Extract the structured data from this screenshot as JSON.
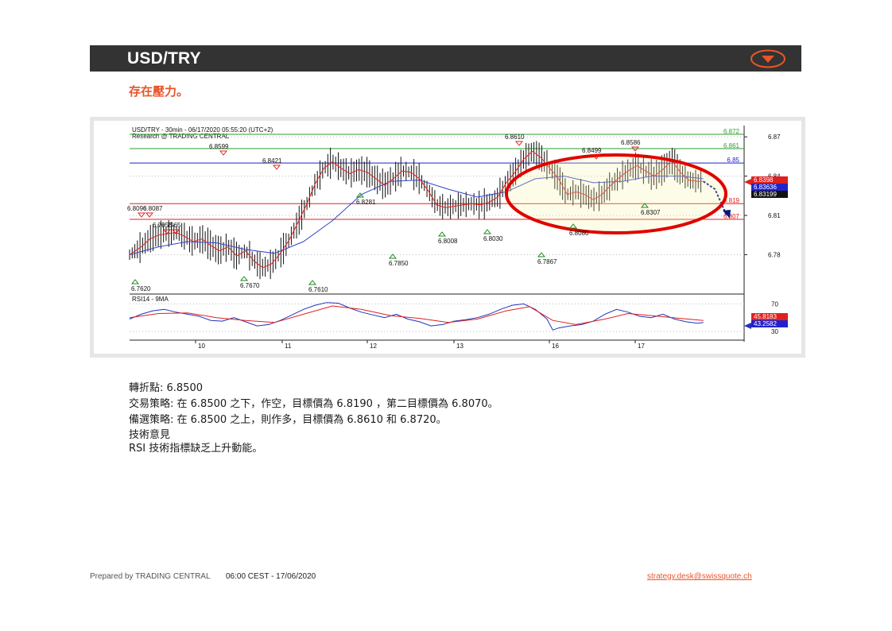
{
  "header": {
    "title": "USD/TRY",
    "menu_icon": "chevron-down-circle-icon",
    "accent": "#e8552a"
  },
  "subtitle": "存在壓力。",
  "chart_data": {
    "type": "line",
    "title": "USD/TRY - 30min - 06/17/2020 05:55:20 (UTC+2)",
    "subtitle": "Research @ TRADING CENTRAL",
    "x_ticks": [
      "10",
      "11",
      "12",
      "13",
      "16",
      "17"
    ],
    "y_ticks": [
      "6.87",
      "6.84",
      "6.81",
      "6.78"
    ],
    "ylim": [
      6.756,
      6.875
    ],
    "levels": [
      {
        "value": 6.872,
        "label": "6.872",
        "color": "#2e9e2e"
      },
      {
        "value": 6.861,
        "label": "6.861",
        "color": "#2e9e2e"
      },
      {
        "value": 6.85,
        "label": "6.85",
        "color": "#2222cc"
      },
      {
        "value": 6.819,
        "label": "6.819",
        "color": "#e02020"
      },
      {
        "value": 6.807,
        "label": "6.807",
        "color": "#e02020"
      }
    ],
    "last_price_tags": [
      {
        "label": "6.8398",
        "color": "#e02020"
      },
      {
        "label": "6.83636",
        "color": "#2222cc"
      },
      {
        "label": "6.83199",
        "color": "#111111"
      }
    ],
    "pivot_highs": [
      "6.8096",
      "6.8087",
      "6.7956",
      "6.7965",
      "6.8599",
      "6.8421",
      "6.8610",
      "6.8499",
      "6.8586"
    ],
    "pivot_lows": [
      "6.7620",
      "6.7670",
      "6.7610",
      "6.8281",
      "6.7850",
      "6.8008",
      "6.8030",
      "6.7867",
      "6.8080",
      "6.8307"
    ],
    "price_path": [
      [
        0,
        6.78
      ],
      [
        4,
        6.786
      ],
      [
        7,
        6.792
      ],
      [
        10,
        6.795
      ],
      [
        13,
        6.796
      ],
      [
        16,
        6.797
      ],
      [
        19,
        6.794
      ],
      [
        22,
        6.79
      ],
      [
        25,
        6.792
      ],
      [
        28,
        6.787
      ],
      [
        31,
        6.783
      ],
      [
        34,
        6.786
      ],
      [
        37,
        6.779
      ],
      [
        40,
        6.783
      ],
      [
        43,
        6.775
      ],
      [
        46,
        6.77
      ],
      [
        49,
        6.773
      ],
      [
        52,
        6.781
      ],
      [
        55,
        6.791
      ],
      [
        58,
        6.804
      ],
      [
        61,
        6.818
      ],
      [
        64,
        6.834
      ],
      [
        67,
        6.846
      ],
      [
        70,
        6.851
      ],
      [
        73,
        6.846
      ],
      [
        76,
        6.842
      ],
      [
        79,
        6.845
      ],
      [
        82,
        6.843
      ],
      [
        85,
        6.838
      ],
      [
        88,
        6.833
      ],
      [
        91,
        6.838
      ],
      [
        94,
        6.844
      ],
      [
        97,
        6.843
      ],
      [
        100,
        6.838
      ],
      [
        103,
        6.829
      ],
      [
        106,
        6.818
      ],
      [
        109,
        6.816
      ],
      [
        112,
        6.817
      ],
      [
        115,
        6.818
      ],
      [
        118,
        6.819
      ],
      [
        121,
        6.818
      ],
      [
        124,
        6.82
      ],
      [
        127,
        6.824
      ],
      [
        130,
        6.835
      ],
      [
        133,
        6.843
      ],
      [
        136,
        6.853
      ],
      [
        139,
        6.859
      ],
      [
        142,
        6.854
      ],
      [
        145,
        6.846
      ],
      [
        148,
        6.838
      ],
      [
        151,
        6.826
      ],
      [
        154,
        6.828
      ],
      [
        157,
        6.826
      ],
      [
        160,
        6.822
      ],
      [
        163,
        6.826
      ],
      [
        166,
        6.833
      ],
      [
        169,
        6.839
      ],
      [
        172,
        6.844
      ],
      [
        175,
        6.848
      ],
      [
        178,
        6.844
      ],
      [
        181,
        6.84
      ],
      [
        184,
        6.845
      ],
      [
        187,
        6.852
      ],
      [
        190,
        6.843
      ],
      [
        193,
        6.837
      ],
      [
        196,
        6.836
      ],
      [
        198,
        6.836
      ]
    ],
    "forecast_path": [
      [
        198,
        6.836
      ],
      [
        202,
        6.83
      ],
      [
        206,
        6.81
      ]
    ],
    "ma_path": [
      [
        0,
        6.78
      ],
      [
        10,
        6.786
      ],
      [
        20,
        6.79
      ],
      [
        30,
        6.789
      ],
      [
        40,
        6.784
      ],
      [
        50,
        6.781
      ],
      [
        60,
        6.79
      ],
      [
        70,
        6.806
      ],
      [
        80,
        6.826
      ],
      [
        90,
        6.836
      ],
      [
        100,
        6.837
      ],
      [
        110,
        6.83
      ],
      [
        120,
        6.824
      ],
      [
        130,
        6.828
      ],
      [
        140,
        6.838
      ],
      [
        150,
        6.84
      ],
      [
        160,
        6.835
      ],
      [
        170,
        6.836
      ],
      [
        180,
        6.84
      ],
      [
        190,
        6.84
      ],
      [
        198,
        6.838
      ]
    ],
    "rsi": {
      "label": "RSI14 - 9MA",
      "ticks": [
        "70",
        "30"
      ],
      "ylim": [
        22,
        82
      ],
      "tags": [
        {
          "label": "45.8183",
          "color": "#e02020"
        },
        {
          "label": "43.2582",
          "color": "#2222cc"
        }
      ],
      "values": [
        [
          0,
          48
        ],
        [
          4,
          55
        ],
        [
          8,
          60
        ],
        [
          12,
          62
        ],
        [
          16,
          58
        ],
        [
          20,
          55
        ],
        [
          24,
          52
        ],
        [
          28,
          46
        ],
        [
          32,
          45
        ],
        [
          36,
          50
        ],
        [
          40,
          44
        ],
        [
          44,
          38
        ],
        [
          48,
          40
        ],
        [
          52,
          46
        ],
        [
          56,
          54
        ],
        [
          60,
          62
        ],
        [
          64,
          68
        ],
        [
          68,
          72
        ],
        [
          72,
          71
        ],
        [
          76,
          64
        ],
        [
          80,
          58
        ],
        [
          84,
          54
        ],
        [
          88,
          50
        ],
        [
          92,
          55
        ],
        [
          96,
          48
        ],
        [
          100,
          44
        ],
        [
          104,
          38
        ],
        [
          108,
          40
        ],
        [
          112,
          45
        ],
        [
          116,
          47
        ],
        [
          120,
          50
        ],
        [
          124,
          55
        ],
        [
          128,
          62
        ],
        [
          132,
          68
        ],
        [
          136,
          70
        ],
        [
          140,
          62
        ],
        [
          144,
          48
        ],
        [
          146,
          32
        ],
        [
          148,
          35
        ],
        [
          152,
          38
        ],
        [
          156,
          40
        ],
        [
          160,
          45
        ],
        [
          164,
          55
        ],
        [
          168,
          62
        ],
        [
          172,
          58
        ],
        [
          176,
          52
        ],
        [
          180,
          50
        ],
        [
          184,
          55
        ],
        [
          188,
          48
        ],
        [
          192,
          44
        ],
        [
          196,
          42
        ],
        [
          198,
          43
        ]
      ],
      "ma": [
        [
          0,
          50
        ],
        [
          10,
          56
        ],
        [
          20,
          57
        ],
        [
          30,
          50
        ],
        [
          40,
          46
        ],
        [
          50,
          43
        ],
        [
          60,
          55
        ],
        [
          70,
          67
        ],
        [
          80,
          62
        ],
        [
          90,
          53
        ],
        [
          100,
          49
        ],
        [
          110,
          43
        ],
        [
          120,
          48
        ],
        [
          130,
          60
        ],
        [
          138,
          66
        ],
        [
          146,
          46
        ],
        [
          154,
          40
        ],
        [
          164,
          48
        ],
        [
          172,
          56
        ],
        [
          180,
          53
        ],
        [
          190,
          49
        ],
        [
          198,
          46
        ]
      ]
    }
  },
  "analysis": {
    "pivot": "轉折點: 6.8500",
    "strategy": "交易策略: 在 6.8500 之下，作空，目標價為  6.8190 ，第二目標價為  6.8070。",
    "alternative": "備選策略: 在 6.8500 之上，則作多，目標價為  6.8610 和 6.8720。",
    "opinion_title": "技術意見",
    "opinion": "RSI 技術指標缺乏上升動能。"
  },
  "footer": {
    "prepared_by": "Prepared by TRADING CENTRAL",
    "timestamp": "06:00 CEST - 17/06/2020",
    "email": "strategy.desk@swissquote.ch"
  }
}
